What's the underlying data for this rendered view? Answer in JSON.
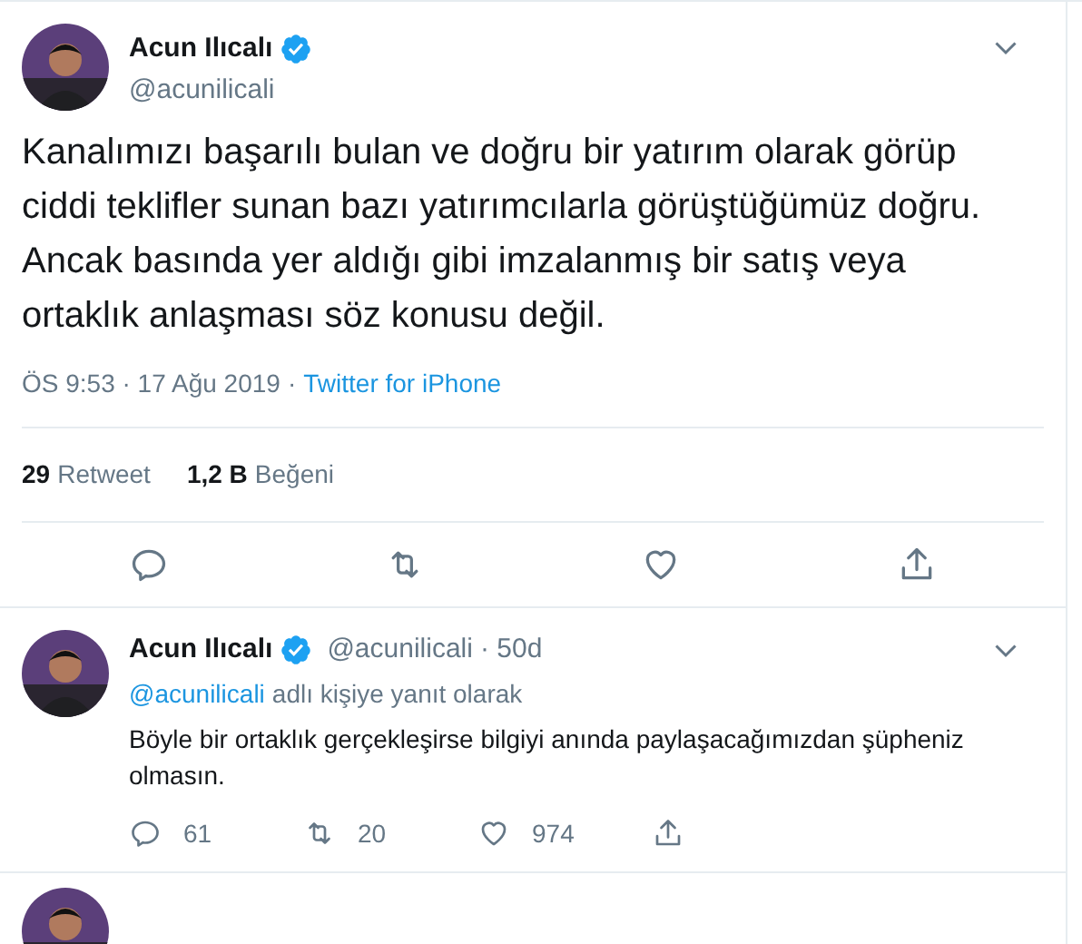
{
  "tweet": {
    "name": "Acun Ilıcalı",
    "verified": true,
    "handle": "@acunilicali",
    "text": "Kanalımızı başarılı bulan ve doğru bir yatırım olarak görüp ciddi teklifler sunan bazı yatırımcılarla görüştüğümüz doğru. Ancak basında yer aldığı gibi imzalanmış bir satış veya ortaklık anlaşması söz konusu değil.",
    "time": "ÖS 9:53 · 17 Ağu 2019",
    "separator": "·",
    "source": "Twitter for iPhone",
    "stats": [
      {
        "count": "29",
        "label": "Retweet"
      },
      {
        "count": "1,2 B",
        "label": "Beğeni"
      }
    ]
  },
  "reply": {
    "name": "Acun Ilıcalı",
    "verified": true,
    "handle": "@acunilicali",
    "age": "· 50d",
    "reply_to": "@acunilicali",
    "reply_note": "adlı kişiye yanıt olarak",
    "text": "Böyle bir ortaklık gerçekleşirse bilgiyi anında paylaşacağımızdan şüpheniz olmasın.",
    "replies": "61",
    "retweets": "20",
    "likes": "974"
  }
}
